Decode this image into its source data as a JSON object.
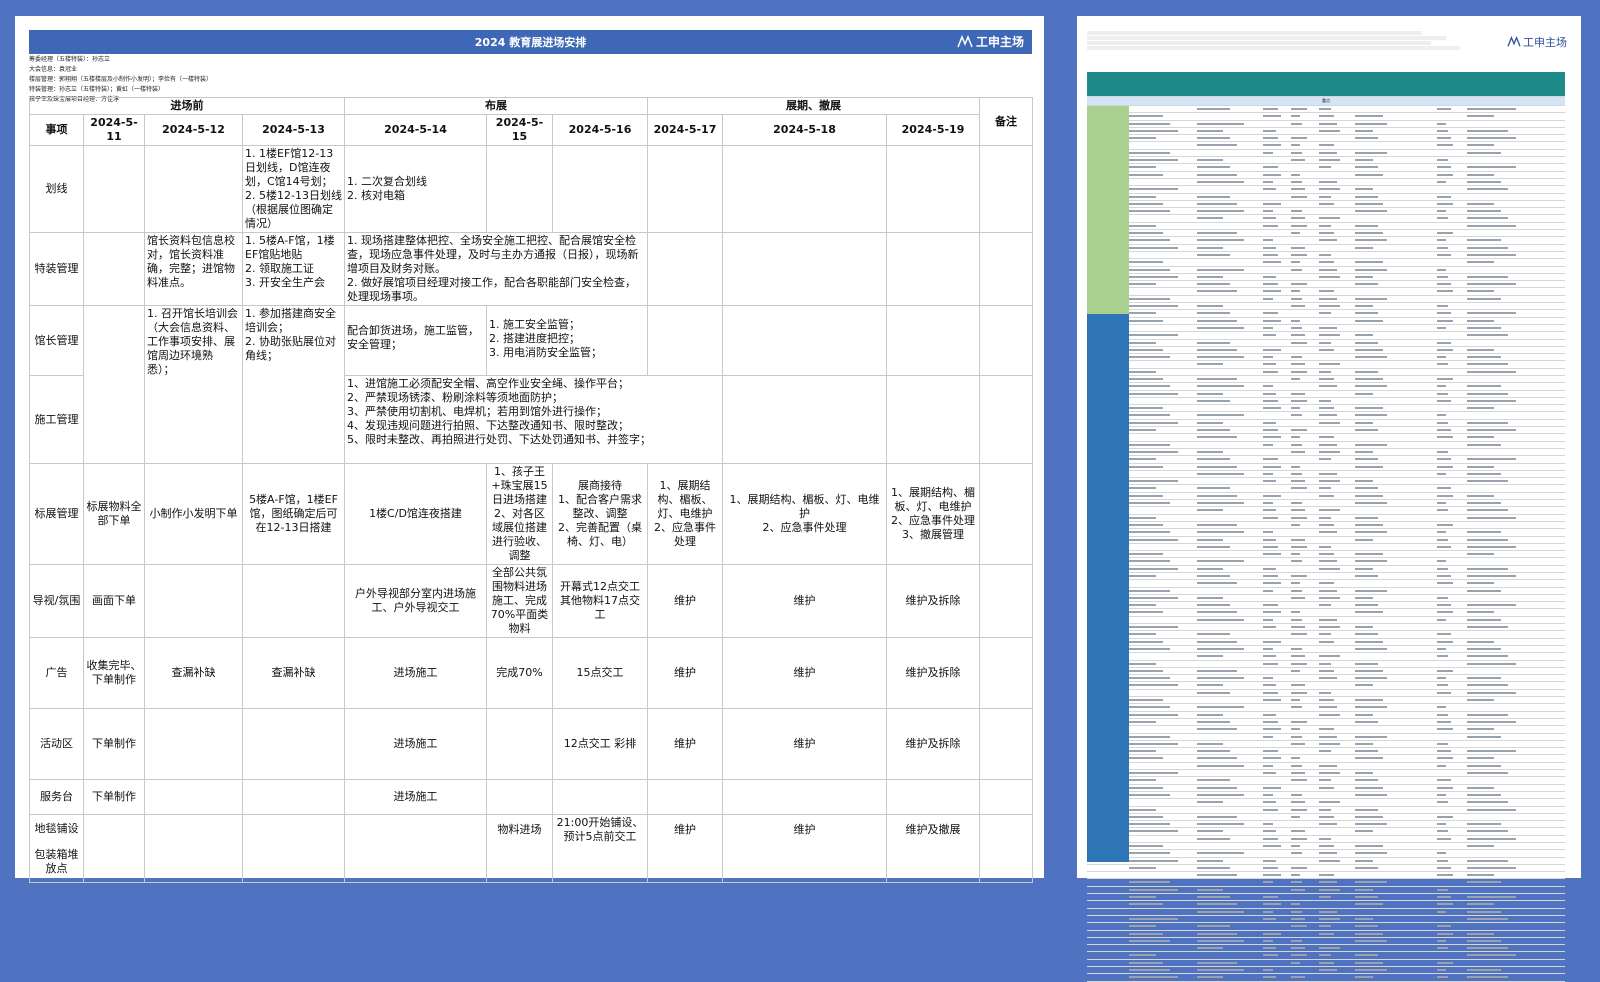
{
  "left_sheet": {
    "title": "2024 教育展进场安排",
    "logo_text": "工申主场",
    "staff_lines": [
      "筹委经理（五楼特装）：孙志立",
      "大会信息：袁冠业",
      "楼层管理：郭翔翔（五楼楼层及小制作小发明）；李俭有（一楼特装）",
      "特装管理：孙志立（五楼特装）；黄虹（一楼特装）",
      "孩子王及珠宝展项目经理：方佳淳"
    ],
    "phases": [
      "进场前",
      "布展",
      "展期、撤展",
      "备注"
    ],
    "header": [
      "事项",
      "2024-5-11",
      "2024-5-12",
      "2024-5-13",
      "2024-5-14",
      "2024-5-15",
      "2024-5-16",
      "2024-5-17",
      "2024-5-18",
      "2024-5-19"
    ],
    "rows": {
      "huaxian": {
        "label": "划线",
        "d13": "1. 1楼EF馆12-13日划线，D馆连夜划，C馆14号划；\n2. 5楼12-13日划线（根据展位图确定情况）",
        "d14": "1. 二次复合划线\n2. 核对电箱"
      },
      "tezhuang": {
        "label": "特装管理",
        "d12": "馆长资料包信息校对，馆长资料准确，完整；进馆物料准点。",
        "d13": "1. 5楼A-F馆，1楼EF馆贴地贴\n2. 领取施工证\n3. 开安全生产会",
        "d14_19": "1. 现场搭建整体把控、全场安全施工把控、配合展馆安全检查，现场应急事件处理，及时与主办方通报（日报），现场新增项目及财务对账。\n2. 做好展馆项目经理对接工作，配合各职能部门安全检查，处理现场事项。"
      },
      "guanzhang": {
        "label": "馆长管理",
        "d12": "1. 召开馆长培训会（大会信息资料、工作事项安排、展馆周边环境熟悉）；",
        "d13": "1. 参加搭建商安全培训会；\n2. 协助张贴展位对角线；",
        "d14": "配合卸货进场，施工监管，安全管理；",
        "d15_16": "1. 施工安全监管；\n2. 搭建进度把控；\n3. 用电消防安全监管；"
      },
      "shigong": {
        "label": "施工管理",
        "d14_19": "1、进馆施工必须配安全帽、高空作业安全绳、操作平台；\n2、严禁现场锈漆、粉刷涂料等须地面防护；\n3、严禁使用切割机、电焊机；若用到馆外进行操作；\n4、发现违规问题进行拍照、下达整改通知书、限时整改；\n5、限时未整改、再拍照进行处罚、下达处罚通知书、并签字；"
      },
      "biaozhan": {
        "label": "标展管理",
        "d11": "标展物料全部下单",
        "d12": "小制作小发明下单",
        "d13": "5楼A-F馆，1楼EF馆，图纸确定后可在12-13日搭建",
        "d14": "1楼C/D馆连夜搭建",
        "d15": "1、孩子王+珠宝展15日进场搭建\n2、对各区域展位搭建进行验收、调整",
        "d16": "展商接待\n1、配合客户需求整改、调整\n2、完善配置（桌椅、灯、电）",
        "d17": "1、展期结构、楣板、灯、电维护\n2、应急事件处理",
        "d18": "1、展期结构、楣板、灯、电维护\n2、应急事件处理",
        "d19": "1、展期结构、楣板、灯、电维护\n2、应急事件处理\n3、撤展管理"
      },
      "daoshi": {
        "label": "导视/氛围",
        "d11": "画面下单",
        "d14": "户外导视部分室内进场施工、户外导视交工",
        "d15": "全部公共氛围物料进场施工、完成70%平面类物料",
        "d16": "开幕式12点交工其他物料17点交工",
        "d17": "维护",
        "d18": "维护",
        "d19": "维护及拆除"
      },
      "guanggao": {
        "label": "广告",
        "d11": "收集完毕、下单制作",
        "d12": "查漏补缺",
        "d13": "查漏补缺",
        "d14": "进场施工",
        "d15": "完成70%",
        "d16": "15点交工",
        "d17": "维护",
        "d18": "维护",
        "d19": "维护及拆除"
      },
      "huodong": {
        "label": "活动区",
        "d11": "下单制作",
        "d14": "进场施工",
        "d16": "12点交工 彩排",
        "d17": "维护",
        "d18": "维护",
        "d19": "维护及拆除"
      },
      "fuwutai": {
        "label": "服务台",
        "d11": "下单制作",
        "d14": "进场施工"
      },
      "ditan": {
        "label": "地毯铺设",
        "label2": "包装箱堆放点",
        "d15": "物料进场",
        "d16": "21:00开始铺设、预计5点前交工",
        "d17": "维护",
        "d18": "维护",
        "d19": "维护及撤展"
      }
    }
  },
  "right_sheet": {
    "logo_text": "工申主场",
    "section_label": "重点"
  },
  "colors": {
    "background": "#4f73c0",
    "title_bar": "#3f67b8",
    "right_header": "#1f8a8a",
    "band_green": "#a9d08e",
    "band_blue": "#2e75b6"
  }
}
